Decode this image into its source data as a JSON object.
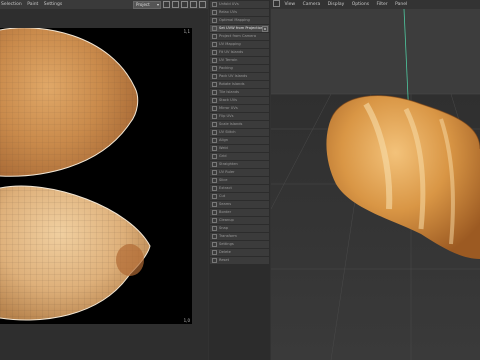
{
  "uv_editor": {
    "menu": [
      "Selection",
      "Paint",
      "Settings"
    ],
    "projection_select": "Project",
    "coord_top_right": "1,1",
    "coord_bottom_right": "1,0"
  },
  "tools": {
    "items": [
      {
        "label": "Unfold UVs",
        "active": false,
        "options": false
      },
      {
        "label": "Relax UVs",
        "active": false,
        "options": false
      },
      {
        "label": "Optimal Mapping",
        "active": false,
        "options": false
      },
      {
        "label": "Set UVW from Projection",
        "active": true,
        "options": true
      },
      {
        "label": "Project from Camera",
        "active": false,
        "options": false
      },
      {
        "label": "UV Mapping",
        "active": false,
        "options": false
      },
      {
        "label": "Fit UV Islands",
        "active": false,
        "options": false
      },
      {
        "label": "UV Terrain",
        "active": false,
        "options": false
      },
      {
        "label": "Packing",
        "active": false,
        "options": false
      },
      {
        "label": "Pack UV Islands",
        "active": false,
        "options": false
      },
      {
        "label": "Rotate Islands",
        "active": false,
        "options": false
      },
      {
        "label": "Tile Islands",
        "active": false,
        "options": false
      },
      {
        "label": "Stack UVs",
        "active": false,
        "options": false
      },
      {
        "label": "Mirror UVs",
        "active": false,
        "options": false
      },
      {
        "label": "Flip UVs",
        "active": false,
        "options": false
      },
      {
        "label": "Scale Islands",
        "active": false,
        "options": false
      },
      {
        "label": "UV Stitch",
        "active": false,
        "options": false
      },
      {
        "label": "Align",
        "active": false,
        "options": false
      },
      {
        "label": "Weld",
        "active": false,
        "options": false
      },
      {
        "label": "Grid",
        "active": false,
        "options": false
      },
      {
        "label": "Straighten",
        "active": false,
        "options": false
      },
      {
        "label": "UV Ruler",
        "active": false,
        "options": false
      },
      {
        "label": "Slice",
        "active": false,
        "options": false
      },
      {
        "label": "Extract",
        "active": false,
        "options": false
      },
      {
        "label": "Cut",
        "active": false,
        "options": false
      },
      {
        "label": "Seams",
        "active": false,
        "options": false
      },
      {
        "label": "Border",
        "active": false,
        "options": false
      },
      {
        "label": "Cleanup",
        "active": false,
        "options": false
      },
      {
        "label": "Snap",
        "active": false,
        "options": false
      },
      {
        "label": "Transform",
        "active": false,
        "options": false
      },
      {
        "label": "Settings",
        "active": false,
        "options": false
      },
      {
        "label": "Delete",
        "active": false,
        "options": false
      },
      {
        "label": "Reset",
        "active": false,
        "options": false
      }
    ]
  },
  "viewport": {
    "menu": [
      "View",
      "Camera",
      "Display",
      "Options",
      "Filter",
      "Panel"
    ]
  }
}
